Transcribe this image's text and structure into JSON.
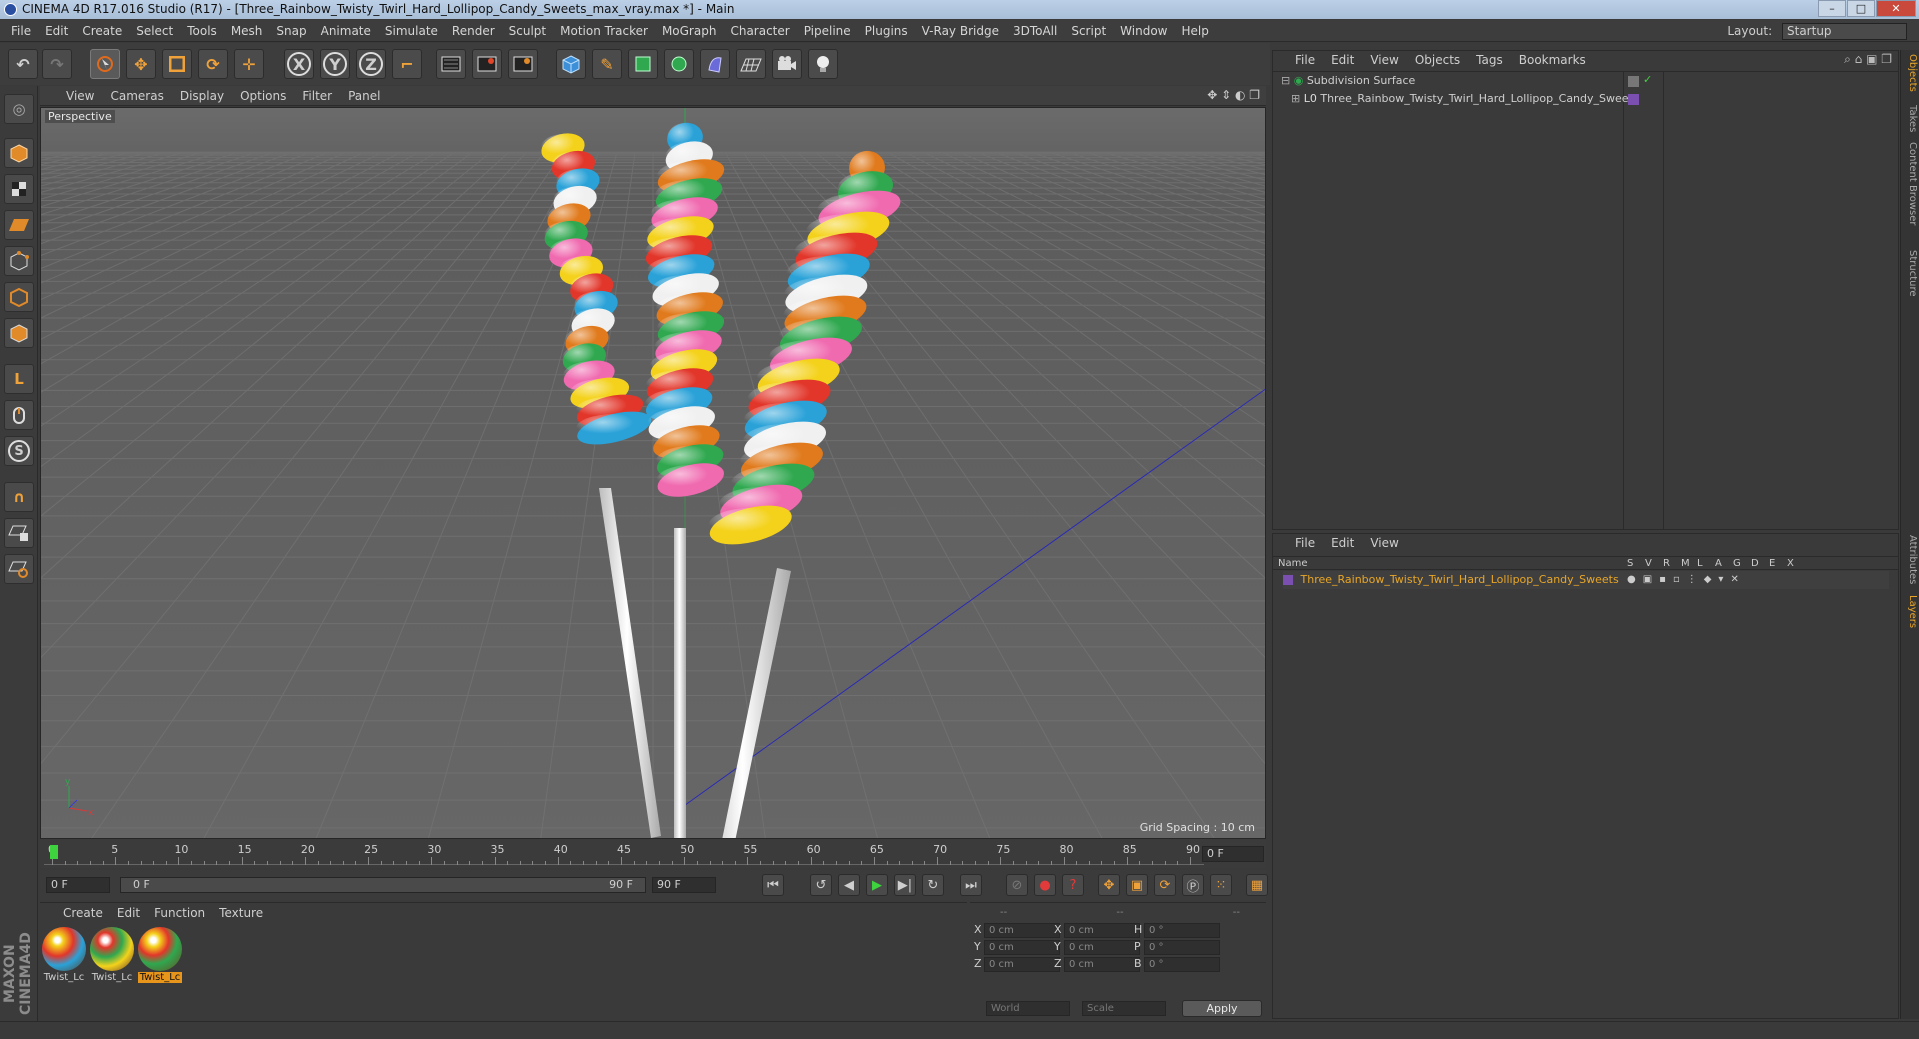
{
  "window": {
    "title": "CINEMA 4D R17.016 Studio (R17) - [Three_Rainbow_Twisty_Twirl_Hard_Lollipop_Candy_Sweets_max_vray.max *] - Main",
    "buttons": {
      "minimize": "–",
      "maximize": "□",
      "close": "✕"
    }
  },
  "menubar": {
    "items": [
      "File",
      "Edit",
      "Create",
      "Select",
      "Tools",
      "Mesh",
      "Snap",
      "Animate",
      "Simulate",
      "Render",
      "Sculpt",
      "Motion Tracker",
      "MoGraph",
      "Character",
      "Pipeline",
      "Plugins",
      "V-Ray Bridge",
      "3DToAll",
      "Script",
      "Window",
      "Help"
    ],
    "layout_label": "Layout:",
    "layout_value": "Startup"
  },
  "toolbar": {
    "icons": [
      "undo-icon",
      "redo-icon",
      "select-pointer-icon",
      "move-icon",
      "scale-icon",
      "rotate-icon",
      "add-object-icon",
      "axis-x-icon",
      "axis-y-icon",
      "axis-z-icon",
      "coordinate-system-icon",
      "render-view-icon",
      "render-picture-viewer-icon",
      "render-settings-icon",
      "cube-primitive-icon",
      "pen-spline-icon",
      "subdivision-icon",
      "array-icon",
      "deformer-icon",
      "floor-icon",
      "camera-icon",
      "light-icon"
    ],
    "axis_labels": [
      "X",
      "Y",
      "Z"
    ]
  },
  "viewport": {
    "menu": [
      "View",
      "Cameras",
      "Display",
      "Options",
      "Filter",
      "Panel"
    ],
    "camera_label": "Perspective",
    "grid_spacing": "Grid Spacing : 10 cm"
  },
  "timeline": {
    "ticks": [
      "0",
      "5",
      "10",
      "15",
      "20",
      "25",
      "30",
      "35",
      "40",
      "45",
      "50",
      "55",
      "60",
      "65",
      "70",
      "75",
      "80",
      "85",
      "90"
    ],
    "current_frame": "0 F",
    "start_field": "0 F",
    "range_start": "0 F",
    "range_end": "90 F",
    "end_field": "90 F"
  },
  "materials": {
    "menu": [
      "Create",
      "Edit",
      "Function",
      "Texture"
    ],
    "items": [
      {
        "label": "Twist_Lc",
        "active": false
      },
      {
        "label": "Twist_Lc",
        "active": false
      },
      {
        "label": "Twist_Lc",
        "active": true
      }
    ]
  },
  "coordinates": {
    "header": [
      "--",
      "--",
      "--"
    ],
    "rows": [
      {
        "axis": "X",
        "pos": "0 cm",
        "axis2": "X",
        "size": "0 cm",
        "rot_label": "H",
        "rot": "0 °"
      },
      {
        "axis": "Y",
        "pos": "0 cm",
        "axis2": "Y",
        "size": "0 cm",
        "rot_label": "P",
        "rot": "0 °"
      },
      {
        "axis": "Z",
        "pos": "0 cm",
        "axis2": "Z",
        "size": "0 cm",
        "rot_label": "B",
        "rot": "0 °"
      }
    ],
    "mode_world": "World",
    "mode_scale": "Scale",
    "apply": "Apply"
  },
  "object_manager": {
    "menu": [
      "File",
      "Edit",
      "View",
      "Objects",
      "Tags",
      "Bookmarks"
    ],
    "objects": [
      {
        "name": "Subdivision Surface",
        "indent": 0
      },
      {
        "name": "Three_Rainbow_Twisty_Twirl_Hard_Lollipop_Candy_Sweets",
        "indent": 1
      }
    ]
  },
  "layer_manager": {
    "menu": [
      "File",
      "Edit",
      "View"
    ],
    "columns": [
      "Name",
      "S",
      "V",
      "R",
      "M",
      "L",
      "A",
      "G",
      "D",
      "E",
      "X"
    ],
    "layers": [
      {
        "name": "Three_Rainbow_Twisty_Twirl_Hard_Lollipop_Candy_Sweets",
        "color": "#7a4fb0"
      }
    ]
  },
  "side_tabs": [
    "Objects",
    "Takes",
    "Content Browser",
    "Structure",
    "Attributes",
    "Layers"
  ],
  "logo_text": "MAXON CINEMA 4D",
  "colors": {
    "accent": "#e8951c",
    "layer_name": "#e8a628",
    "timeline_cursor": "#3fd23f"
  }
}
